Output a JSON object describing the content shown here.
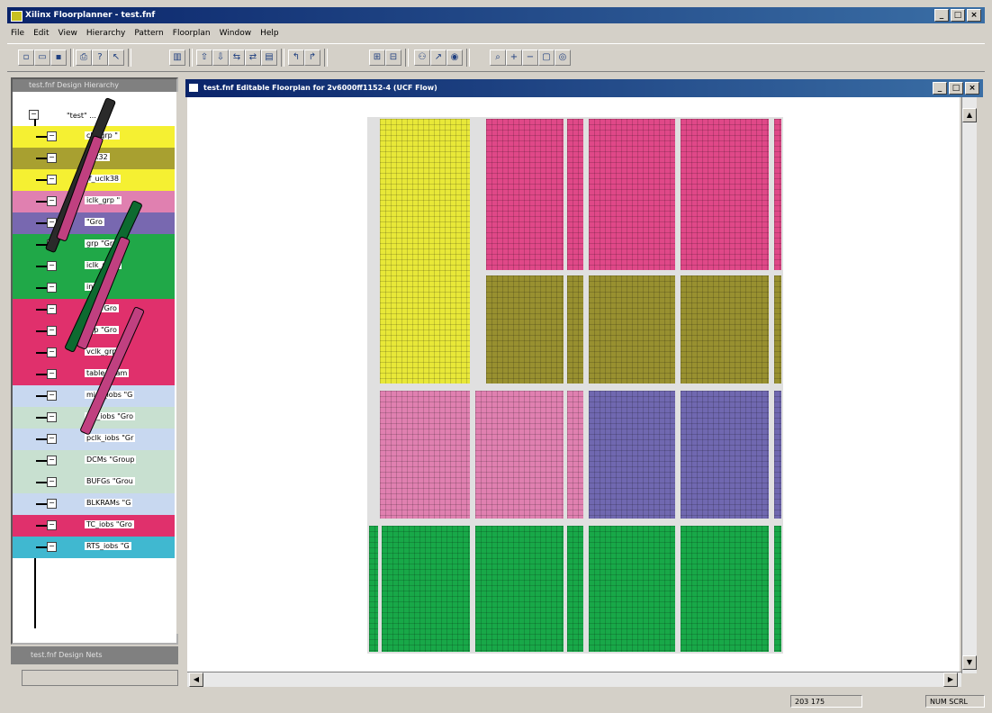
{
  "window": {
    "title": "Xilinx Floorplanner - test.fnf",
    "controls": [
      "_",
      "□",
      "×"
    ]
  },
  "menu": [
    "File",
    "Edit",
    "View",
    "Hierarchy",
    "Pattern",
    "Floorplan",
    "Window",
    "Help"
  ],
  "toolbar": {
    "icons": [
      "new-icon",
      "open-icon",
      "save-icon",
      "print-icon",
      "help-icon",
      "whats-this-icon",
      "tool-icon",
      "place-icon",
      "unplace-icon",
      "route-icon",
      "move-icon",
      "constraint-icon",
      "undo-icon",
      "redo-icon",
      "group-icon",
      "ungroup-icon",
      "hierarchy-icon",
      "ratsnest-icon",
      "select-icon",
      "zoom-fit-icon",
      "zoom-in-icon",
      "zoom-out-icon",
      "zoom-area-icon",
      "zoom-select-icon"
    ]
  },
  "left_pane": {
    "title": "test.fnf Design Hierarchy",
    "root_label": "\"test\" ...",
    "items": [
      {
        "label": "clk_grp \"",
        "color": "#f5f032"
      },
      {
        "label": "iclk32",
        "color": "#a8a030"
      },
      {
        "label": "ff_uclk38",
        "color": "#f5f032"
      },
      {
        "label": "iclk_grp \"",
        "color": "#e080b0"
      },
      {
        "label": "\"Gro",
        "color": "#7868b0"
      },
      {
        "label": "grp \"Gro",
        "color": "#20a848"
      },
      {
        "label": "iclk_pb_g",
        "color": "#20a848"
      },
      {
        "label": "in_g",
        "color": "#20a848"
      },
      {
        "label": "grp \"Gro",
        "color": "#e0306c"
      },
      {
        "label": "grp \"Gro",
        "color": "#e0306c"
      },
      {
        "label": "vclk_grp \"",
        "color": "#e0306c"
      },
      {
        "label": "table_bram",
        "color": "#e0306c"
      },
      {
        "label": "misc_iobs \"G",
        "color": "#c8d8f0"
      },
      {
        "label": "clk_iobs \"Gro",
        "color": "#c8e0d0"
      },
      {
        "label": "pclk_iobs \"Gr",
        "color": "#c8d8f0"
      },
      {
        "label": "DCMs \"Group",
        "color": "#c8e0d0"
      },
      {
        "label": "BUFGs \"Grou",
        "color": "#c8e0d0"
      },
      {
        "label": "BLKRAMs \"G",
        "color": "#c8d8f0"
      },
      {
        "label": "TC_iobs \"Gro",
        "color": "#e0306c"
      },
      {
        "label": "RTS_iobs \"G",
        "color": "#40b8d0"
      }
    ],
    "status_title": "test.fnf Design Nets"
  },
  "editor": {
    "title": "test.fnf Editable Floorplan for 2v6000ff1152-4  (UCF Flow)",
    "controls": [
      "_",
      "□",
      "×"
    ]
  },
  "colors": {
    "yellow": "#e8e838",
    "magenta": "#e04888",
    "olive": "#989030",
    "pink": "#e080b0",
    "purple": "#7068b0",
    "green": "#18a848"
  },
  "statusbar": {
    "coords": "203 175",
    "mode": "NUM  SCRL"
  }
}
